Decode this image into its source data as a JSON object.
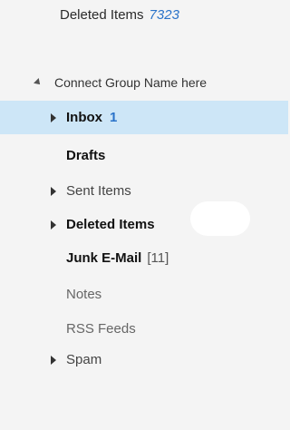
{
  "top_item": {
    "label": "Deleted Items",
    "count": "7323"
  },
  "group": {
    "label": "Connect Group Name here"
  },
  "folders": [
    {
      "label": "Inbox",
      "count": "1",
      "style": "bold",
      "expandable": true,
      "selected": true
    },
    {
      "label": "Drafts",
      "count": "",
      "style": "bold",
      "expandable": false,
      "selected": false
    },
    {
      "label": "Sent Items",
      "count": "",
      "style": "normal",
      "expandable": true,
      "selected": false
    },
    {
      "label": "Deleted Items",
      "count": "",
      "style": "bold",
      "expandable": true,
      "selected": false
    },
    {
      "label": "Junk E-Mail",
      "count": "[11]",
      "style": "bold",
      "expandable": false,
      "selected": false
    },
    {
      "label": "Notes",
      "count": "",
      "style": "muted",
      "expandable": false,
      "selected": false
    },
    {
      "label": "RSS Feeds",
      "count": "",
      "style": "muted",
      "expandable": false,
      "selected": false
    },
    {
      "label": "Spam",
      "count": "",
      "style": "normal",
      "expandable": true,
      "selected": false
    }
  ],
  "colors": {
    "selection": "#cde6f7",
    "count_blue": "#2a73c9",
    "pane_bg": "#f4f4f4"
  }
}
